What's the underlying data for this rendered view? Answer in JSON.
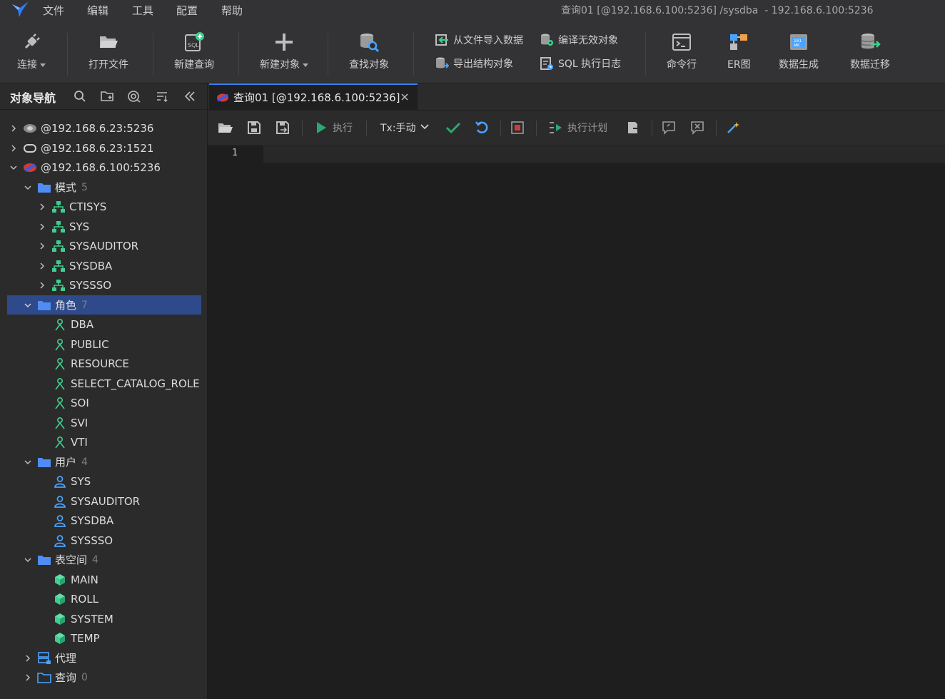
{
  "menubar": {
    "items": [
      "文件",
      "编辑",
      "工具",
      "配置",
      "帮助"
    ],
    "window_title": "查询01 [@192.168.6.100:5236] /sysdba  - 192.168.6.100:5236"
  },
  "toolbar": {
    "connect": "连接",
    "open_file": "打开文件",
    "new_query": "新建查询",
    "new_object": "新建对象",
    "find_object": "查找对象",
    "import_from_file": "从文件导入数据",
    "export_structure": "导出结构对象",
    "compile_invalid": "编译无效对象",
    "sql_exec_log": "SQL 执行日志",
    "command_line": "命令行",
    "er_diagram": "ER图",
    "data_generation": "数据生成",
    "data_migration": "数据迁移"
  },
  "navigator": {
    "title": "对象导航",
    "tree": [
      {
        "label": "@192.168.6.23:5236",
        "count": ""
      },
      {
        "label": "@192.168.6.23:1521",
        "count": ""
      },
      {
        "label": "@192.168.6.100:5236",
        "count": ""
      },
      {
        "label": "模式",
        "count": "5"
      },
      {
        "label": "CTISYS",
        "count": ""
      },
      {
        "label": "SYS",
        "count": ""
      },
      {
        "label": "SYSAUDITOR",
        "count": ""
      },
      {
        "label": "SYSDBA",
        "count": ""
      },
      {
        "label": "SYSSSO",
        "count": ""
      },
      {
        "label": "角色",
        "count": "7"
      },
      {
        "label": "DBA",
        "count": ""
      },
      {
        "label": "PUBLIC",
        "count": ""
      },
      {
        "label": "RESOURCE",
        "count": ""
      },
      {
        "label": "SELECT_CATALOG_ROLE",
        "count": ""
      },
      {
        "label": "SOI",
        "count": ""
      },
      {
        "label": "SVI",
        "count": ""
      },
      {
        "label": "VTI",
        "count": ""
      },
      {
        "label": "用户",
        "count": "4"
      },
      {
        "label": "SYS",
        "count": ""
      },
      {
        "label": "SYSAUDITOR",
        "count": ""
      },
      {
        "label": "SYSDBA",
        "count": ""
      },
      {
        "label": "SYSSSO",
        "count": ""
      },
      {
        "label": "表空间",
        "count": "4"
      },
      {
        "label": "MAIN",
        "count": ""
      },
      {
        "label": "ROLL",
        "count": ""
      },
      {
        "label": "SYSTEM",
        "count": ""
      },
      {
        "label": "TEMP",
        "count": ""
      },
      {
        "label": "代理",
        "count": ""
      },
      {
        "label": "查询",
        "count": "0"
      }
    ]
  },
  "editor": {
    "tab_label": "查询01 [@192.168.6.100:5236]",
    "execute": "执行",
    "tx_mode": "Tx:手动",
    "explain_plan": "执行计划",
    "line_number": "1"
  },
  "colors": {
    "accent": "#3b82f6",
    "folder": "#4f8df5",
    "schema_green": "#3ecf8e",
    "selected_row": "#2e4a8a"
  }
}
